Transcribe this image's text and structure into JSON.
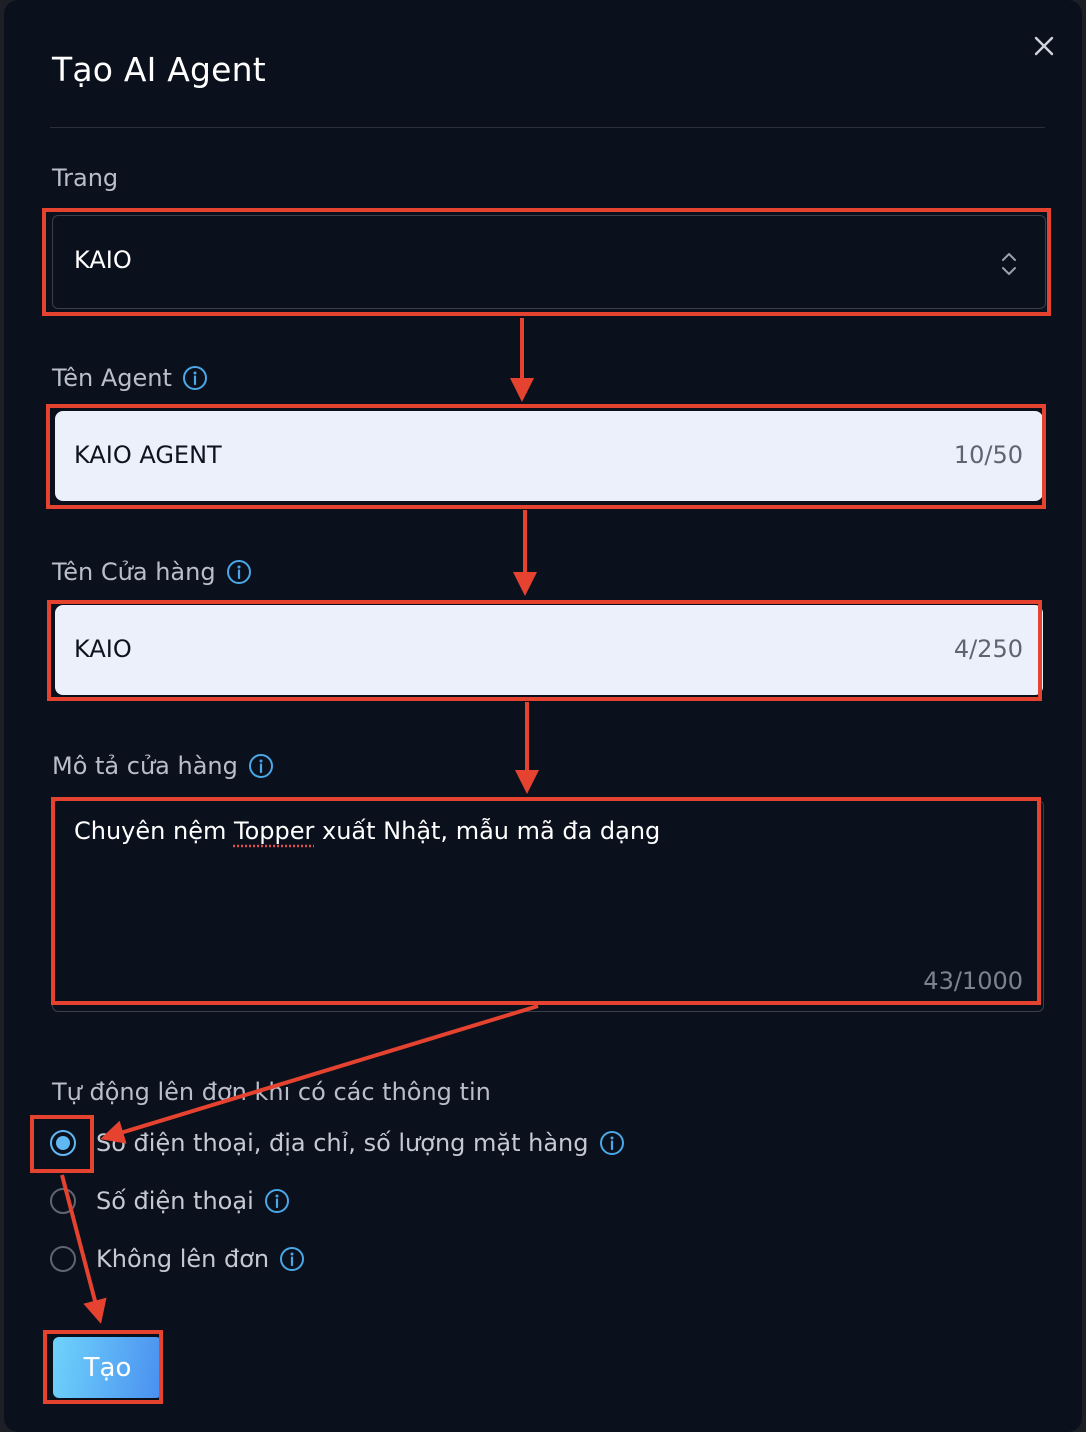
{
  "modal": {
    "title": "Tạo AI Agent",
    "close_icon": "close-icon"
  },
  "fields": {
    "page": {
      "label": "Trang",
      "value": "KAIO",
      "icon": "chevron-updown-icon"
    },
    "agent_name": {
      "label": "Tên Agent",
      "value": "KAIO AGENT",
      "counter": "10/50",
      "icon": "info-icon"
    },
    "store_name": {
      "label": "Tên Cửa hàng",
      "value": "KAIO",
      "counter": "4/250",
      "icon": "info-icon"
    },
    "store_desc": {
      "label": "Mô tả cửa hàng",
      "value_before": "Chuyên nệm ",
      "value_misspelled": "Topper",
      "value_after": " xuất Nhật, mẫu mã đa dạng",
      "counter": "43/1000",
      "icon": "info-icon"
    }
  },
  "auto_order": {
    "label": "Tự động lên đơn khi có các thông tin",
    "options": [
      {
        "label": "Số điện thoại, địa chỉ, số lượng mặt hàng",
        "selected": true
      },
      {
        "label": "Số điện thoại",
        "selected": false
      },
      {
        "label": "Không lên đơn",
        "selected": false
      }
    ]
  },
  "submit_label": "Tạo",
  "colors": {
    "background": "#0b101d",
    "accent": "#5fb8f2",
    "annotation": "#e5432f",
    "input_fill": "#ebf0fb"
  }
}
